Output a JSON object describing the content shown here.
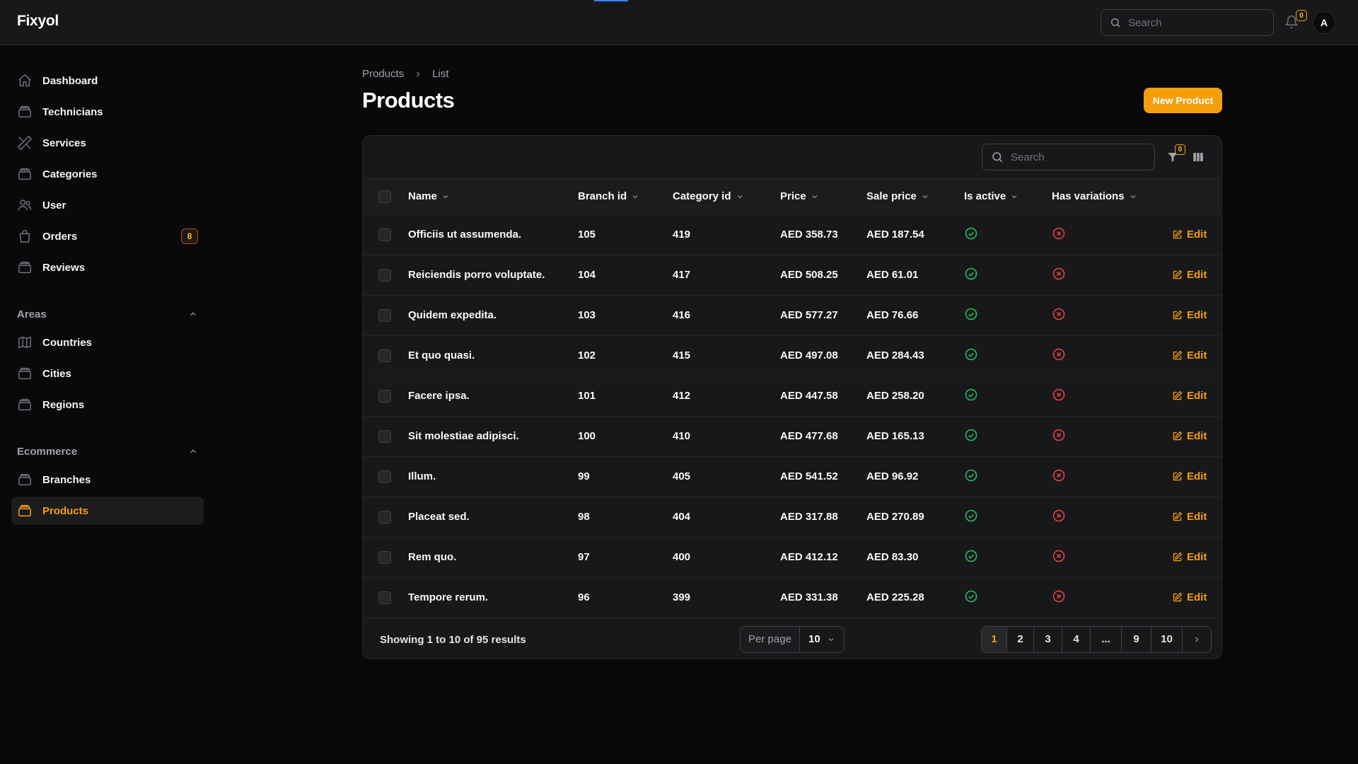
{
  "app": {
    "brand": "Fixyol"
  },
  "topbar": {
    "search_placeholder": "Search",
    "notifications_count": "0",
    "avatar_initial": "A"
  },
  "sidebar": {
    "items": [
      {
        "label": "Dashboard",
        "icon": "home-icon"
      },
      {
        "label": "Technicians",
        "icon": "box-icon"
      },
      {
        "label": "Services",
        "icon": "tools-icon"
      },
      {
        "label": "Categories",
        "icon": "box-icon"
      },
      {
        "label": "User",
        "icon": "users-icon"
      },
      {
        "label": "Orders",
        "icon": "shopping-bag-icon",
        "badge": "8"
      },
      {
        "label": "Reviews",
        "icon": "box-icon"
      }
    ],
    "groups": [
      {
        "label": "Areas",
        "items": [
          {
            "label": "Countries",
            "icon": "map-icon"
          },
          {
            "label": "Cities",
            "icon": "box-icon"
          },
          {
            "label": "Regions",
            "icon": "box-icon"
          }
        ]
      },
      {
        "label": "Ecommerce",
        "items": [
          {
            "label": "Branches",
            "icon": "box-icon"
          },
          {
            "label": "Products",
            "icon": "box-icon",
            "active": true
          }
        ]
      }
    ]
  },
  "breadcrumb": {
    "parent": "Products",
    "current": "List"
  },
  "page": {
    "title": "Products",
    "new_button": "New Product"
  },
  "table": {
    "search_placeholder": "Search",
    "filter_count": "0",
    "columns": [
      "Name",
      "Branch id",
      "Category id",
      "Price",
      "Sale price",
      "Is active",
      "Has variations"
    ],
    "edit_label": "Edit",
    "rows": [
      {
        "name": "Officiis ut assumenda.",
        "branch_id": "105",
        "category_id": "419",
        "price": "AED 358.73",
        "sale_price": "AED 187.54",
        "is_active": true,
        "has_variations": false
      },
      {
        "name": "Reiciendis porro voluptate.",
        "branch_id": "104",
        "category_id": "417",
        "price": "AED 508.25",
        "sale_price": "AED 61.01",
        "is_active": true,
        "has_variations": false
      },
      {
        "name": "Quidem expedita.",
        "branch_id": "103",
        "category_id": "416",
        "price": "AED 577.27",
        "sale_price": "AED 76.66",
        "is_active": true,
        "has_variations": false
      },
      {
        "name": "Et quo quasi.",
        "branch_id": "102",
        "category_id": "415",
        "price": "AED 497.08",
        "sale_price": "AED 284.43",
        "is_active": true,
        "has_variations": false
      },
      {
        "name": "Facere ipsa.",
        "branch_id": "101",
        "category_id": "412",
        "price": "AED 447.58",
        "sale_price": "AED 258.20",
        "is_active": true,
        "has_variations": false
      },
      {
        "name": "Sit molestiae adipisci.",
        "branch_id": "100",
        "category_id": "410",
        "price": "AED 477.68",
        "sale_price": "AED 165.13",
        "is_active": true,
        "has_variations": false
      },
      {
        "name": "Illum.",
        "branch_id": "99",
        "category_id": "405",
        "price": "AED 541.52",
        "sale_price": "AED 96.92",
        "is_active": true,
        "has_variations": false
      },
      {
        "name": "Placeat sed.",
        "branch_id": "98",
        "category_id": "404",
        "price": "AED 317.88",
        "sale_price": "AED 270.89",
        "is_active": true,
        "has_variations": false
      },
      {
        "name": "Rem quo.",
        "branch_id": "97",
        "category_id": "400",
        "price": "AED 412.12",
        "sale_price": "AED 83.30",
        "is_active": true,
        "has_variations": false
      },
      {
        "name": "Tempore rerum.",
        "branch_id": "96",
        "category_id": "399",
        "price": "AED 331.38",
        "sale_price": "AED 225.28",
        "is_active": true,
        "has_variations": false
      }
    ]
  },
  "footer": {
    "results_text": "Showing 1 to 10 of 95 results",
    "per_page_label": "Per page",
    "per_page_value": "10",
    "pages": [
      "1",
      "2",
      "3",
      "4",
      "...",
      "9",
      "10"
    ],
    "current_page": "1"
  },
  "colors": {
    "accent": "#f59e0b",
    "success": "#22c55e",
    "danger": "#ef4444",
    "background": "#09090b",
    "surface": "#18181b"
  }
}
